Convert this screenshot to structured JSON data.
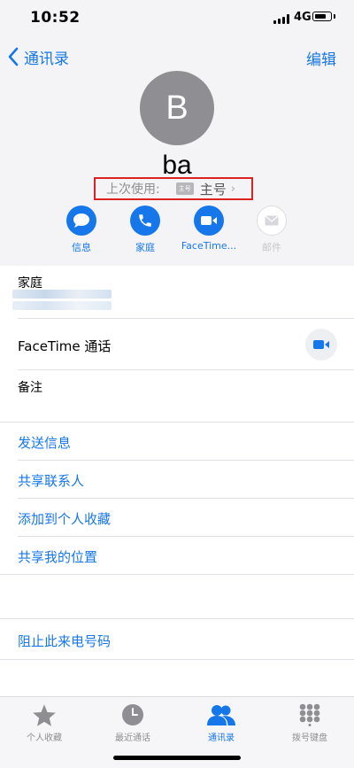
{
  "status_bar": {
    "time": "10:52",
    "network": "4G"
  },
  "nav": {
    "back_label": "通讯录",
    "edit_label": "编辑"
  },
  "contact": {
    "avatar_letter": "B",
    "name": "ba",
    "last_used_label": "上次使用:",
    "last_used_tag": "主号",
    "last_used_number": "主号"
  },
  "actions": [
    {
      "label": "信息",
      "icon": "message-icon"
    },
    {
      "label": "家庭",
      "icon": "phone-icon"
    },
    {
      "label": "FaceTime...",
      "icon": "video-icon"
    },
    {
      "label": "邮件",
      "icon": "mail-icon"
    }
  ],
  "details": {
    "phone_label": "家庭",
    "facetime_label": "FaceTime 通话",
    "notes_label": "备注"
  },
  "links": {
    "send_message": "发送信息",
    "share_contact": "共享联系人",
    "add_favorites": "添加到个人收藏",
    "share_location": "共享我的位置",
    "block_caller": "阻止此来电号码"
  },
  "tabbar": [
    {
      "label": "个人收藏",
      "icon": "star-icon",
      "active": false
    },
    {
      "label": "最近通话",
      "icon": "clock-icon",
      "active": false
    },
    {
      "label": "通讯录",
      "icon": "contacts-icon",
      "active": true
    },
    {
      "label": "拨号键盘",
      "icon": "keypad-icon",
      "active": false
    }
  ],
  "colors": {
    "accent": "#1677ea",
    "highlight_box": "#dd2222",
    "avatar_bg": "#8e8e93"
  }
}
